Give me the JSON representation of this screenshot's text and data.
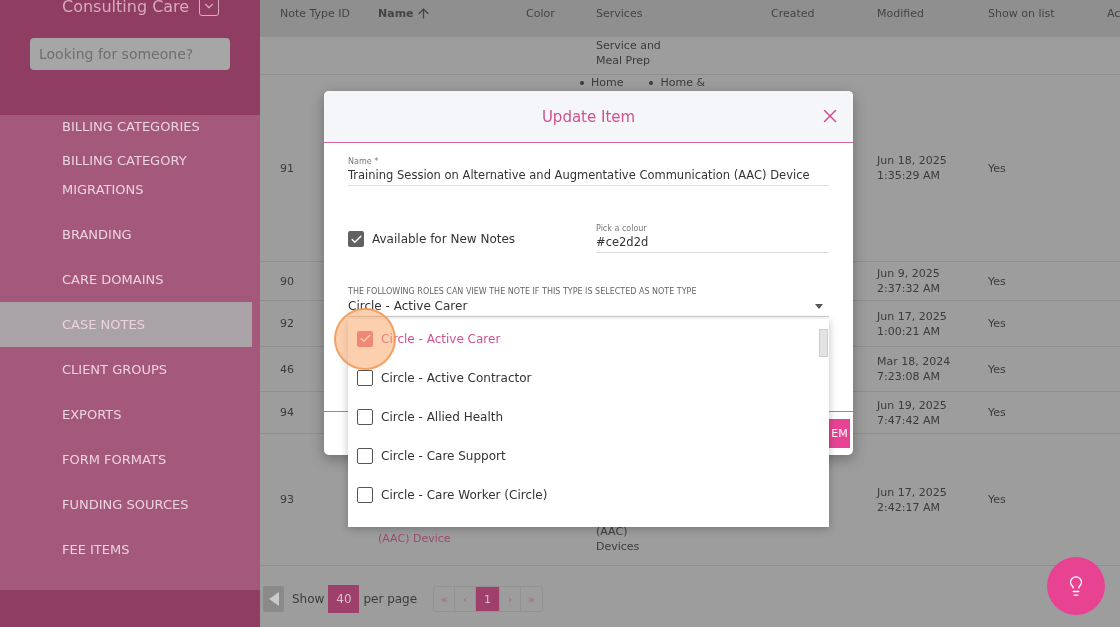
{
  "sidebar": {
    "org_name": "Consulting Care",
    "search": {
      "placeholder": "Looking for someone?"
    },
    "items": [
      {
        "label": "BILLING CATEGORIES",
        "selected": false
      },
      {
        "label": "BILLING CATEGORY MIGRATIONS",
        "selected": false
      },
      {
        "label": "BRANDING",
        "selected": false
      },
      {
        "label": "CARE DOMAINS",
        "selected": false
      },
      {
        "label": "CASE NOTES",
        "selected": true
      },
      {
        "label": "CLIENT GROUPS",
        "selected": false
      },
      {
        "label": "EXPORTS",
        "selected": false
      },
      {
        "label": "FORM FORMATS",
        "selected": false
      },
      {
        "label": "FUNDING SOURCES",
        "selected": false
      },
      {
        "label": "FEE ITEMS",
        "selected": false
      }
    ]
  },
  "table": {
    "columns": [
      {
        "label": "Note Type ID",
        "sorted": false
      },
      {
        "label": "Name",
        "sorted": true
      },
      {
        "label": "Color",
        "sorted": false
      },
      {
        "label": "Services",
        "sorted": false
      },
      {
        "label": "Created",
        "sorted": false
      },
      {
        "label": "Modified",
        "sorted": false
      },
      {
        "label": "Show on list",
        "sorted": false
      },
      {
        "label": "Ac",
        "sorted": false
      }
    ],
    "rows": [
      {
        "services": {
          "kind": "lines",
          "items": [
            "Service and",
            "Meal Prep"
          ]
        }
      },
      {
        "id": "91",
        "services": {
          "kind": "bullets",
          "items": [
            "Home",
            "Home &"
          ]
        },
        "modified": [
          "Jun 18, 2025",
          "1:35:29 AM"
        ],
        "show_on_list": "Yes"
      },
      {
        "id": "90",
        "modified": [
          "Jun 9, 2025",
          "2:37:32 AM"
        ],
        "show_on_list": "Yes"
      },
      {
        "id": "92",
        "modified": [
          "Jun 17, 2025",
          "1:00:21 AM"
        ],
        "show_on_list": "Yes"
      },
      {
        "id": "46",
        "modified": [
          "Mar 18, 2024",
          "7:23:08 AM"
        ],
        "show_on_list": "Yes"
      },
      {
        "id": "94",
        "modified": [
          "Jun 19, 2025",
          "7:47:42 AM"
        ],
        "show_on_list": "Yes"
      },
      {
        "id": "93",
        "name": "(AAC) Device",
        "services": {
          "kind": "lines",
          "items": [
            "(AAC)",
            "Devices"
          ]
        },
        "modified": [
          "Jun 17, 2025",
          "2:42:17 AM"
        ],
        "show_on_list": "Yes"
      }
    ]
  },
  "pagination": {
    "show_label": "Show",
    "page_size": "40",
    "per_page_label": "per page",
    "pages": [
      {
        "label": "«",
        "selected": false
      },
      {
        "label": "‹",
        "selected": false
      },
      {
        "label": "1",
        "selected": true
      },
      {
        "label": "›",
        "selected": false
      },
      {
        "label": "»",
        "selected": false
      }
    ]
  },
  "dialog": {
    "title": "Update Item",
    "name_field": {
      "label": "Name *",
      "value": "Training Session on Alternative and Augmentative Communication (AAC) Device"
    },
    "available_checkbox": {
      "label": "Available for New Notes",
      "checked": true
    },
    "colour_field": {
      "label": "Pick a colour",
      "value": "#ce2d2d"
    },
    "roles_select": {
      "label": "THE FOLLOWING ROLES CAN VIEW THE NOTE IF THIS TYPE IS SELECTED AS NOTE TYPE",
      "value": "Circle - Active Carer",
      "expanded": true,
      "options": [
        {
          "label": "Circle - Active Carer",
          "checked": true
        },
        {
          "label": "Circle - Active Contractor",
          "checked": false
        },
        {
          "label": "Circle - Allied Health",
          "checked": false
        },
        {
          "label": "Circle - Care Support",
          "checked": false
        },
        {
          "label": "Circle - Care Worker (Circle)",
          "checked": false
        }
      ]
    },
    "submit_button": "EM"
  }
}
